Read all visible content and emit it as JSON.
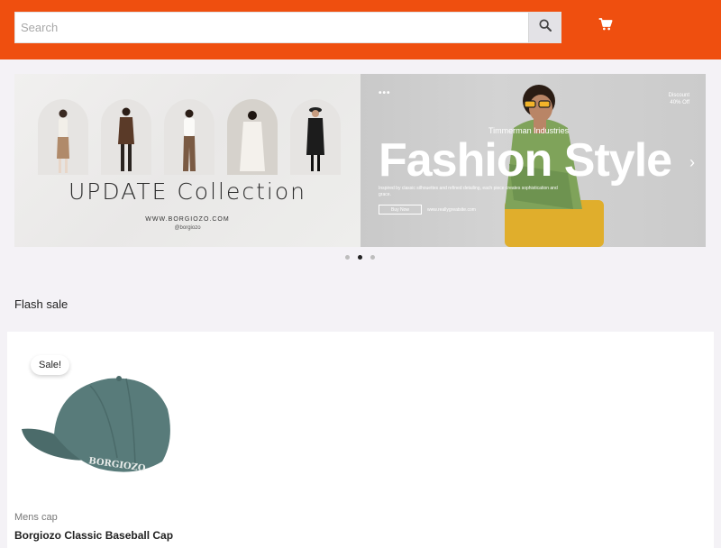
{
  "header": {
    "search_placeholder": "Search",
    "search_value": "",
    "search_icon": "search-icon",
    "cart_icon": "cart-icon",
    "brand_color": "#ef4f0f"
  },
  "carousel": {
    "slides": [
      {
        "title": "UPDATE Collection",
        "url": "WWW.BORGIOZO.COM",
        "handle": "@borgiozo"
      },
      {
        "menu_dots": "•••",
        "discount_line1": "Discount",
        "discount_line2": "40% Off",
        "company": "Timmerman Industries",
        "title": "Fashion Style",
        "description": "Inspired by classic silhouettes and refined detailing, each piece creates sophistication and grace.",
        "button_label": "Buy Now",
        "url": "www.reallygreatsite.com"
      }
    ],
    "active_index": 1,
    "page_count": 3
  },
  "flash_sale": {
    "section_title": "Flash sale",
    "products": [
      {
        "badge": "Sale!",
        "category": "Mens cap",
        "name": "Borgiozo Classic Baseball Cap",
        "image_icon": "baseball-cap-image",
        "cap_text": "BORGIOZO"
      }
    ]
  }
}
